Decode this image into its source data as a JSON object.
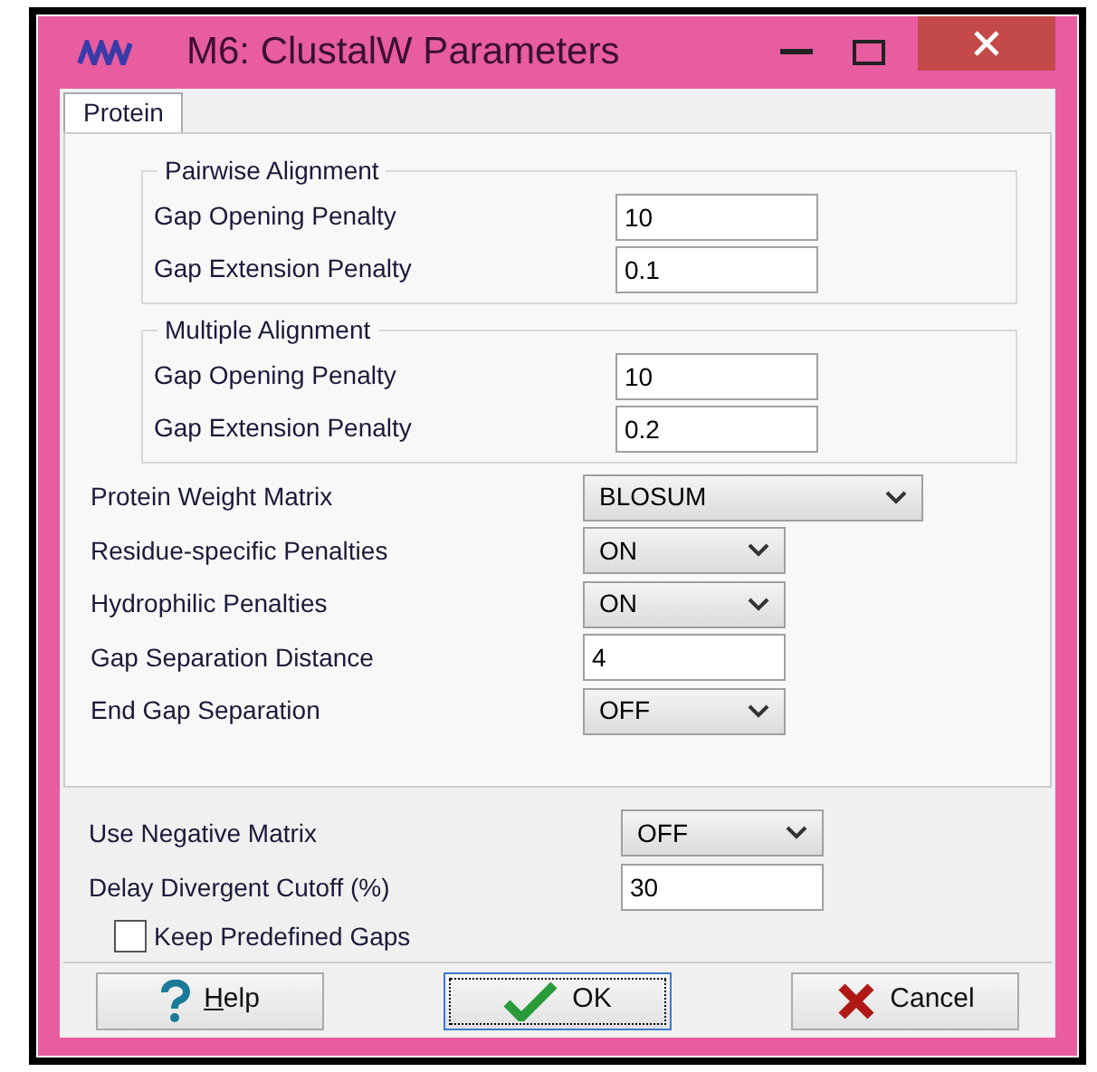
{
  "window": {
    "title": "M6: ClustalW Parameters"
  },
  "tabs": [
    {
      "label": "Protein",
      "selected": true
    }
  ],
  "groups": [
    {
      "title": "Pairwise Alignment",
      "fields": [
        {
          "kind": "text",
          "label": "Gap Opening Penalty",
          "value": "10"
        },
        {
          "kind": "text",
          "label": "Gap Extension Penalty",
          "value": "0.1"
        }
      ]
    },
    {
      "title": "Multiple Alignment",
      "fields": [
        {
          "kind": "text",
          "label": "Gap Opening Penalty",
          "value": "10"
        },
        {
          "kind": "text",
          "label": "Gap Extension Penalty",
          "value": "0.2"
        }
      ]
    }
  ],
  "fields": [
    {
      "kind": "select",
      "label": "Protein Weight Matrix",
      "value": "BLOSUM",
      "wide": true
    },
    {
      "kind": "select",
      "label": "Residue-specific Penalties",
      "value": "ON"
    },
    {
      "kind": "select",
      "label": "Hydrophilic Penalties",
      "value": "ON"
    },
    {
      "kind": "text",
      "label": "Gap Separation Distance",
      "value": "4"
    },
    {
      "kind": "select",
      "label": "End Gap Separation",
      "value": "OFF"
    }
  ],
  "bottom_fields": [
    {
      "kind": "select",
      "label": "Use Negative Matrix",
      "value": "OFF"
    },
    {
      "kind": "text",
      "label": "Delay Divergent Cutoff (%)",
      "value": "30"
    }
  ],
  "checkbox": {
    "label": "Keep Predefined Gaps",
    "checked": false
  },
  "buttons": [
    {
      "kind": "help",
      "label": "Help",
      "mnemonic": true
    },
    {
      "kind": "ok",
      "label": "OK"
    },
    {
      "kind": "cancel",
      "label": "Cancel"
    }
  ]
}
